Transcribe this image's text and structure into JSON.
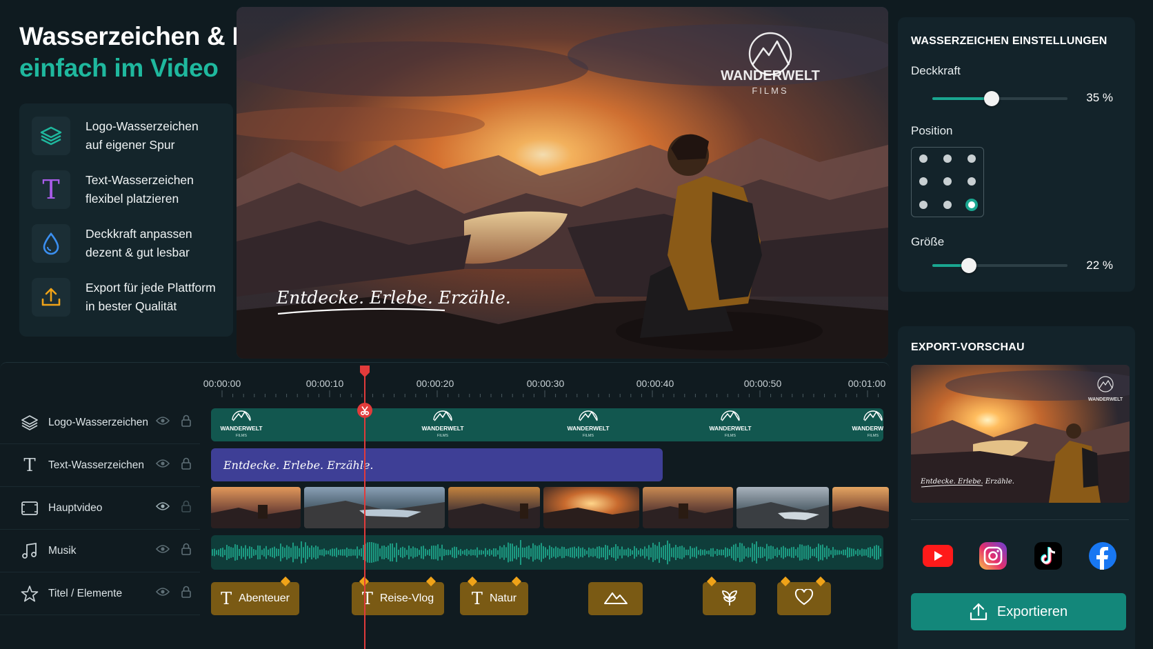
{
  "headline": {
    "line1": "Wasserzeichen & Branding",
    "line2": "einfach im Video"
  },
  "features": [
    {
      "icon": "layers-icon",
      "line1": "Logo-Wasserzeichen",
      "line2": "auf eigener Spur",
      "color": "#1fb89e"
    },
    {
      "icon": "text-t-icon",
      "line1": "Text-Wasserzeichen",
      "line2": "flexibel platzieren",
      "color": "#a85ce8"
    },
    {
      "icon": "droplet-icon",
      "line1": "Deckkraft anpassen",
      "line2": "dezent & gut lesbar",
      "color": "#3b8ff0"
    },
    {
      "icon": "upload-icon",
      "line1": "Export für jede Plattform",
      "line2": "in bester Qualität",
      "color": "#f0a318"
    }
  ],
  "preview": {
    "watermark_logo_line1": "WANDERWELT",
    "watermark_logo_line2": "FILMS",
    "watermark_text": "Entdecke. Erlebe. Erzähle."
  },
  "settings": {
    "title": "WASSERZEICHEN EINSTELLUNGEN",
    "opacity_label": "Deckkraft",
    "opacity_value": "35 %",
    "opacity_fraction": 0.44,
    "position_label": "Position",
    "position_selected": "bottom-right",
    "size_label": "Größe",
    "size_value": "22 %",
    "size_fraction": 0.27,
    "accent": "#1aa690"
  },
  "export": {
    "title": "EXPORT-VORSCHAU",
    "thumb_text": "Entdecke. Erlebe. Erzähle.",
    "platforms": [
      "youtube-icon",
      "instagram-icon",
      "tiktok-icon",
      "facebook-icon"
    ],
    "button_label": "Exportieren"
  },
  "timeline": {
    "ruler": [
      "00:00:00",
      "00:00:10",
      "00:00:20",
      "00:00:30",
      "00:00:40",
      "00:00:50",
      "00:01:00"
    ],
    "tracks": [
      {
        "name": "Logo-Wasserzeichen",
        "icon": "layers-icon"
      },
      {
        "name": "Text-Wasserzeichen",
        "icon": "text-t-icon"
      },
      {
        "name": "Hauptvideo",
        "icon": "video-frame-icon"
      },
      {
        "name": "Musik",
        "icon": "music-note-icon"
      },
      {
        "name": "Titel / Elemente",
        "icon": "star-icon"
      }
    ],
    "logo_clip_text": "WANDERWELT",
    "logo_clip_sub": "FILMS",
    "text_clip": "Entdecke. Erlebe. Erzähle.",
    "title_clips": [
      {
        "label": "Abenteuer",
        "type": "text"
      },
      {
        "label": "Reise-Vlog",
        "type": "text"
      },
      {
        "label": "Natur",
        "type": "text"
      },
      {
        "label": "",
        "type": "mountain-icon"
      },
      {
        "label": "",
        "type": "plant-icon"
      },
      {
        "label": "",
        "type": "heart-icon"
      }
    ]
  }
}
